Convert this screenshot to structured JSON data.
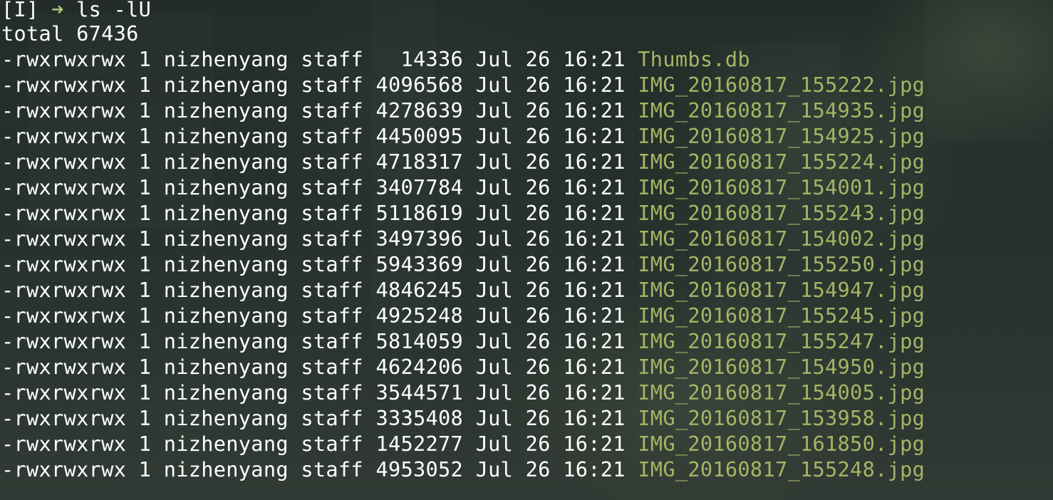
{
  "prompt": {
    "mode": "[I]",
    "arrow": "➜",
    "command": "ls -lU"
  },
  "total_line": "total 67436",
  "columns": [
    "permissions",
    "links",
    "owner",
    "group",
    "size",
    "month",
    "day",
    "time",
    "name"
  ],
  "rows": [
    {
      "permissions": "-rwxrwxrwx",
      "links": "1",
      "owner": "nizhenyang",
      "group": "staff",
      "size": "14336",
      "month": "Jul",
      "day": "26",
      "time": "16:21",
      "name": "Thumbs.db"
    },
    {
      "permissions": "-rwxrwxrwx",
      "links": "1",
      "owner": "nizhenyang",
      "group": "staff",
      "size": "4096568",
      "month": "Jul",
      "day": "26",
      "time": "16:21",
      "name": "IMG_20160817_155222.jpg"
    },
    {
      "permissions": "-rwxrwxrwx",
      "links": "1",
      "owner": "nizhenyang",
      "group": "staff",
      "size": "4278639",
      "month": "Jul",
      "day": "26",
      "time": "16:21",
      "name": "IMG_20160817_154935.jpg"
    },
    {
      "permissions": "-rwxrwxrwx",
      "links": "1",
      "owner": "nizhenyang",
      "group": "staff",
      "size": "4450095",
      "month": "Jul",
      "day": "26",
      "time": "16:21",
      "name": "IMG_20160817_154925.jpg"
    },
    {
      "permissions": "-rwxrwxrwx",
      "links": "1",
      "owner": "nizhenyang",
      "group": "staff",
      "size": "4718317",
      "month": "Jul",
      "day": "26",
      "time": "16:21",
      "name": "IMG_20160817_155224.jpg"
    },
    {
      "permissions": "-rwxrwxrwx",
      "links": "1",
      "owner": "nizhenyang",
      "group": "staff",
      "size": "3407784",
      "month": "Jul",
      "day": "26",
      "time": "16:21",
      "name": "IMG_20160817_154001.jpg"
    },
    {
      "permissions": "-rwxrwxrwx",
      "links": "1",
      "owner": "nizhenyang",
      "group": "staff",
      "size": "5118619",
      "month": "Jul",
      "day": "26",
      "time": "16:21",
      "name": "IMG_20160817_155243.jpg"
    },
    {
      "permissions": "-rwxrwxrwx",
      "links": "1",
      "owner": "nizhenyang",
      "group": "staff",
      "size": "3497396",
      "month": "Jul",
      "day": "26",
      "time": "16:21",
      "name": "IMG_20160817_154002.jpg"
    },
    {
      "permissions": "-rwxrwxrwx",
      "links": "1",
      "owner": "nizhenyang",
      "group": "staff",
      "size": "5943369",
      "month": "Jul",
      "day": "26",
      "time": "16:21",
      "name": "IMG_20160817_155250.jpg"
    },
    {
      "permissions": "-rwxrwxrwx",
      "links": "1",
      "owner": "nizhenyang",
      "group": "staff",
      "size": "4846245",
      "month": "Jul",
      "day": "26",
      "time": "16:21",
      "name": "IMG_20160817_154947.jpg"
    },
    {
      "permissions": "-rwxrwxrwx",
      "links": "1",
      "owner": "nizhenyang",
      "group": "staff",
      "size": "4925248",
      "month": "Jul",
      "day": "26",
      "time": "16:21",
      "name": "IMG_20160817_155245.jpg"
    },
    {
      "permissions": "-rwxrwxrwx",
      "links": "1",
      "owner": "nizhenyang",
      "group": "staff",
      "size": "5814059",
      "month": "Jul",
      "day": "26",
      "time": "16:21",
      "name": "IMG_20160817_155247.jpg"
    },
    {
      "permissions": "-rwxrwxrwx",
      "links": "1",
      "owner": "nizhenyang",
      "group": "staff",
      "size": "4624206",
      "month": "Jul",
      "day": "26",
      "time": "16:21",
      "name": "IMG_20160817_154950.jpg"
    },
    {
      "permissions": "-rwxrwxrwx",
      "links": "1",
      "owner": "nizhenyang",
      "group": "staff",
      "size": "3544571",
      "month": "Jul",
      "day": "26",
      "time": "16:21",
      "name": "IMG_20160817_154005.jpg"
    },
    {
      "permissions": "-rwxrwxrwx",
      "links": "1",
      "owner": "nizhenyang",
      "group": "staff",
      "size": "3335408",
      "month": "Jul",
      "day": "26",
      "time": "16:21",
      "name": "IMG_20160817_153958.jpg"
    },
    {
      "permissions": "-rwxrwxrwx",
      "links": "1",
      "owner": "nizhenyang",
      "group": "staff",
      "size": "1452277",
      "month": "Jul",
      "day": "26",
      "time": "16:21",
      "name": "IMG_20160817_161850.jpg"
    },
    {
      "permissions": "-rwxrwxrwx",
      "links": "1",
      "owner": "nizhenyang",
      "group": "staff",
      "size": "4953052",
      "month": "Jul",
      "day": "26",
      "time": "16:21",
      "name": "IMG_20160817_155248.jpg"
    }
  ],
  "colors": {
    "text": "#ffffff",
    "filename": "#a5b564",
    "prompt_arrow": "#a7c27a"
  }
}
